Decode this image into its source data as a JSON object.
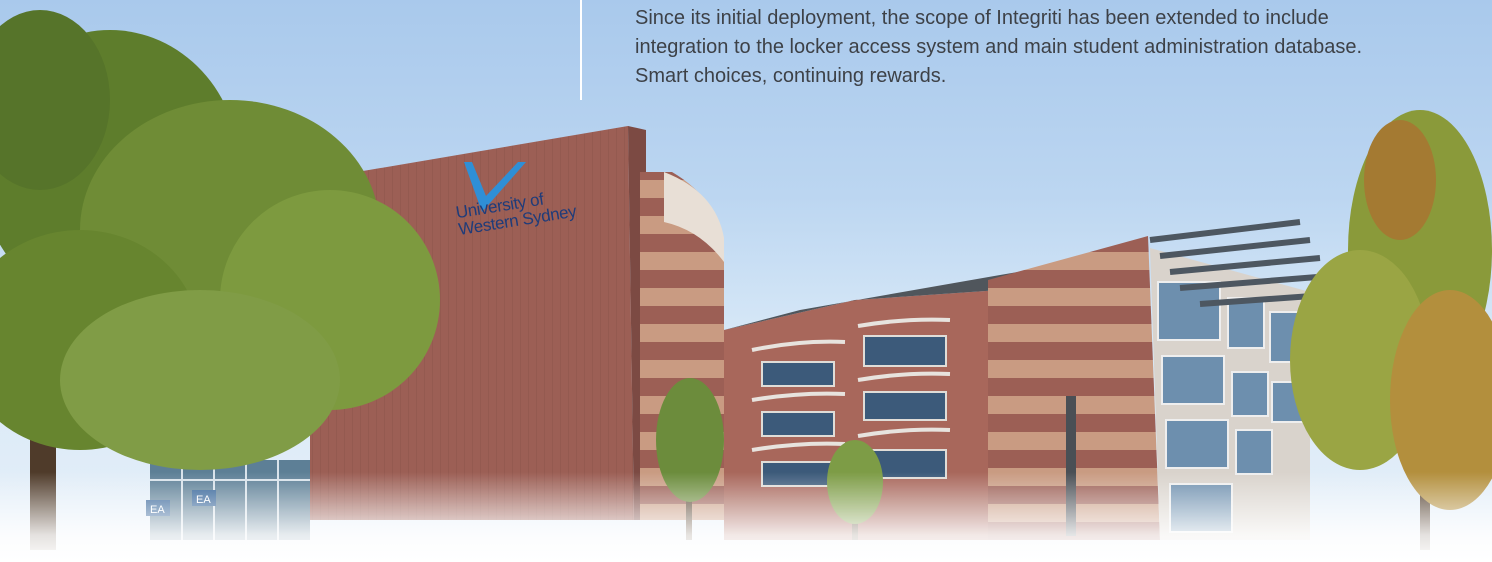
{
  "caption": {
    "lines": [
      "Since its initial deployment, the scope of Integriti has been extended to include",
      "integration to the locker access system and main student administration database.",
      "Smart choices, continuing rewards."
    ]
  },
  "building": {
    "logo_lines": [
      "University of",
      "Western Sydney"
    ],
    "entrance_signs": [
      "EA",
      "EA"
    ]
  },
  "colors": {
    "sky_top": "#a9c9ec",
    "brick": "#9c5f55",
    "sandstone": "#c99b82",
    "foliage": "#6f8c36",
    "logo_navy": "#1f3c7a",
    "logo_blue": "#2f8fd6",
    "text": "#3d4147"
  }
}
